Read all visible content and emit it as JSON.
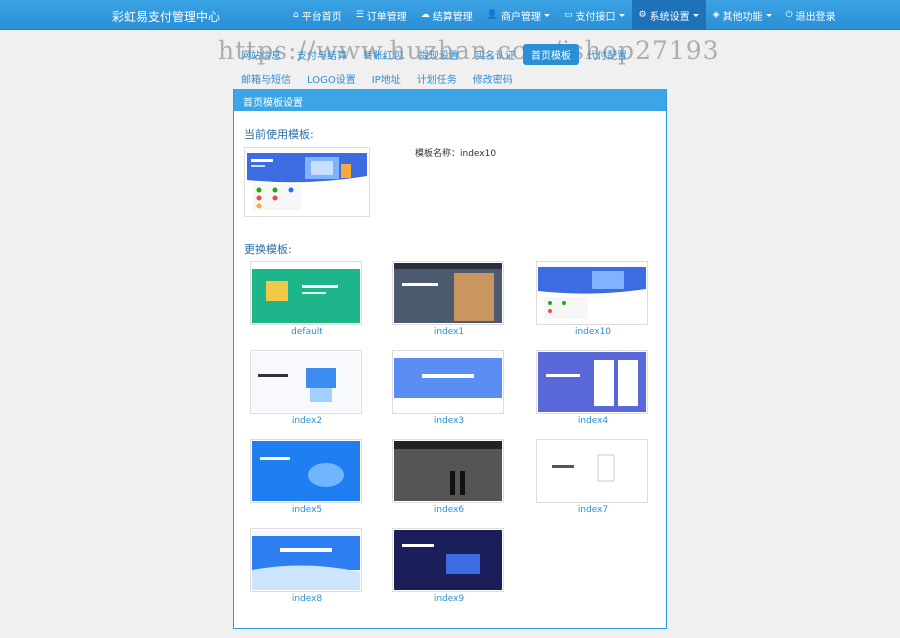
{
  "app": {
    "title": "彩虹易支付管理中心"
  },
  "nav": [
    {
      "icon": "home-icon",
      "glyph": "⌂",
      "label": "平台首页",
      "dropdown": false
    },
    {
      "icon": "list-icon",
      "glyph": "☰",
      "label": "订单管理",
      "dropdown": false
    },
    {
      "icon": "cloud-icon",
      "glyph": "☁",
      "label": "结算管理",
      "dropdown": false
    },
    {
      "icon": "user-icon",
      "glyph": "👤",
      "label": "商户管理",
      "dropdown": true
    },
    {
      "icon": "card-icon",
      "glyph": "▭",
      "label": "支付接口",
      "dropdown": true
    },
    {
      "icon": "gear-icon",
      "glyph": "⚙",
      "label": "系统设置",
      "dropdown": true
    },
    {
      "icon": "cube-icon",
      "glyph": "◈",
      "label": "其他功能",
      "dropdown": true
    },
    {
      "icon": "power-icon",
      "glyph": "⏻",
      "label": "退出登录",
      "dropdown": false
    }
  ],
  "watermark": "https://www.huzhan.com/ishop27193",
  "tabs_row1": [
    "网站信息",
    "支付与结算",
    "转账红包",
    "提现设置",
    "实名认证",
    "首页模板",
    "代付配置"
  ],
  "tabs_row2": [
    "邮箱与短信",
    "LOGO设置",
    "IP地址",
    "计划任务",
    "修改密码"
  ],
  "active_tab": "首页模板",
  "panel": {
    "title": "首页模板设置",
    "current_label": "当前使用模板:",
    "template_name": "模板名称：index10",
    "change_label": "更换模板:"
  },
  "templates": [
    "default",
    "index1",
    "index10",
    "index2",
    "index3",
    "index4",
    "index5",
    "index6",
    "index7",
    "index8",
    "index9"
  ]
}
